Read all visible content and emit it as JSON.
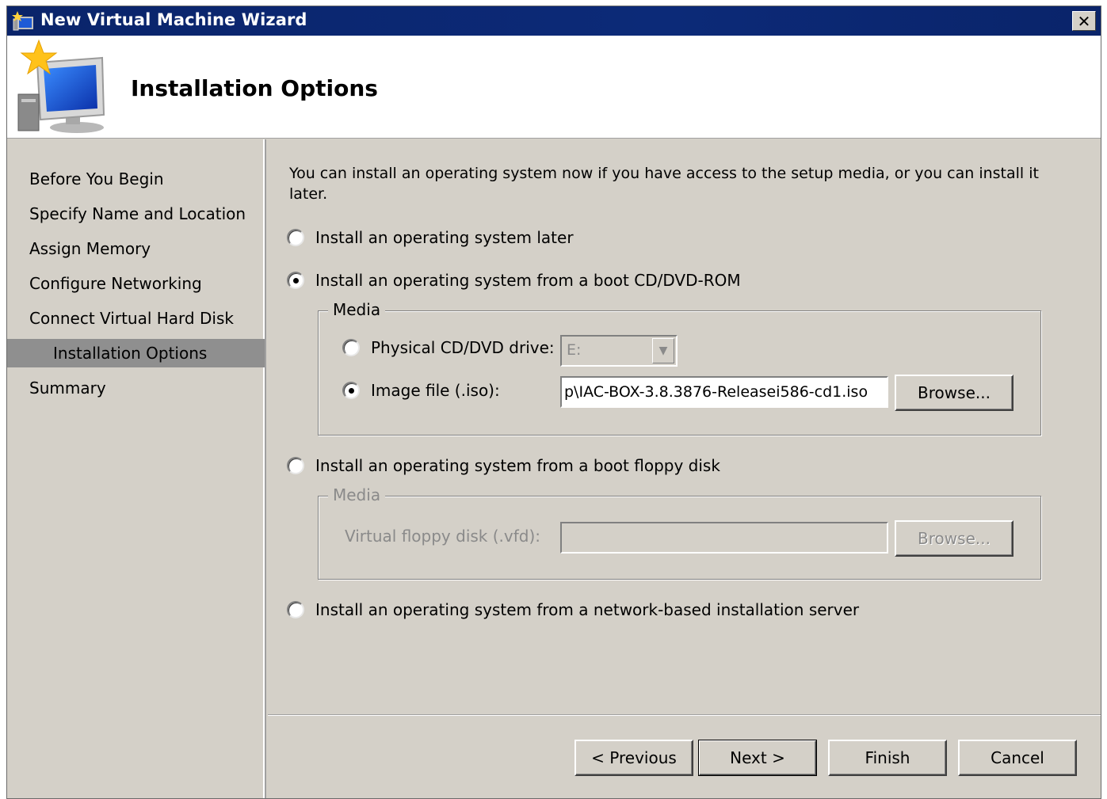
{
  "window": {
    "title": "New Virtual Machine Wizard",
    "close_label": "✕"
  },
  "header": {
    "page_title": "Installation Options"
  },
  "sidebar": {
    "steps": [
      {
        "label": "Before You Begin"
      },
      {
        "label": "Specify Name and Location"
      },
      {
        "label": "Assign Memory"
      },
      {
        "label": "Configure Networking"
      },
      {
        "label": "Connect Virtual Hard Disk"
      },
      {
        "label": "Installation Options",
        "active": true
      },
      {
        "label": "Summary"
      }
    ]
  },
  "content": {
    "intro": "You can install an operating system now if you have access to the setup media, or you can install it later.",
    "options": {
      "later": {
        "label": "Install an operating system later",
        "checked": false
      },
      "cd_dvd": {
        "label": "Install an operating system from a boot CD/DVD-ROM",
        "checked": true
      },
      "floppy": {
        "label": "Install an operating system from a boot floppy disk",
        "checked": false
      },
      "network": {
        "label": "Install an operating system from a network-based installation server",
        "checked": false
      }
    },
    "cd_media": {
      "legend": "Media",
      "physical_label": "Physical CD/DVD drive:",
      "physical_checked": false,
      "drive_value": "E:",
      "image_label": "Image file (.iso):",
      "image_checked": true,
      "image_value": "p\\IAC-BOX-3.8.3876-Releasei586-cd1.iso",
      "browse_label": "Browse..."
    },
    "floppy_media": {
      "legend": "Media",
      "vfd_label": "Virtual floppy disk (.vfd):",
      "vfd_value": "",
      "browse_label": "Browse..."
    }
  },
  "buttons": {
    "previous": "< Previous",
    "next": "Next >",
    "finish": "Finish",
    "cancel": "Cancel"
  }
}
